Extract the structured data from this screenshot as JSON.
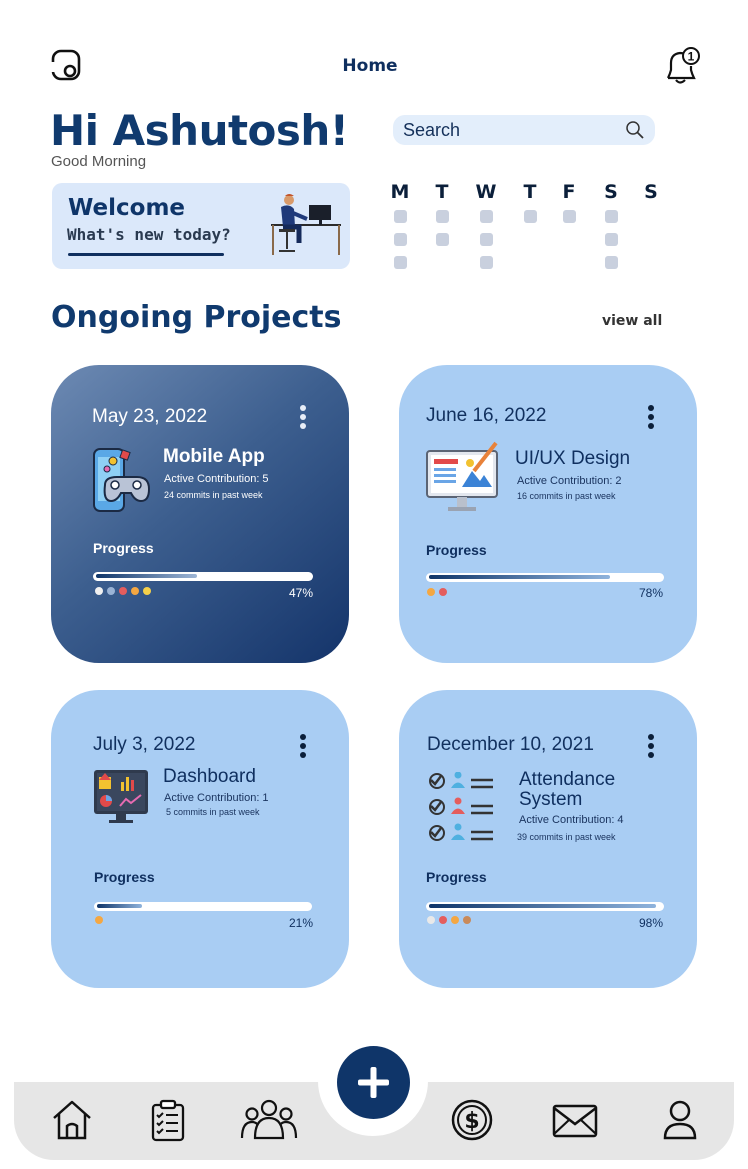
{
  "header": {
    "title": "Home",
    "notification_count": "1"
  },
  "greeting": {
    "title": "Hi Ashutosh!",
    "subtitle": "Good Morning"
  },
  "search": {
    "placeholder": "Search"
  },
  "welcome_card": {
    "title": "Welcome",
    "subtitle": "What's new today?"
  },
  "calendar": {
    "days": [
      "M",
      "T",
      "W",
      "T",
      "F",
      "S",
      "S"
    ],
    "dots_per_day": [
      3,
      2,
      3,
      1,
      1,
      3,
      0
    ]
  },
  "projects": {
    "title": "Ongoing Projects",
    "view_all": "view all",
    "items": [
      {
        "date": "May 23, 2022",
        "name": "Mobile App",
        "contribution": "Active Contribution: 5",
        "commits": "24 commits in past week",
        "progress_label": "Progress",
        "progress": 47,
        "progress_text": "47%",
        "avatar_icons": [
          "avatar",
          "avatar",
          "avatar",
          "avatar",
          "avatar"
        ],
        "icon": "gamepad-phone-icon"
      },
      {
        "date": "June 16, 2022",
        "name": "UI/UX Design",
        "contribution": "Active Contribution: 2",
        "commits": "16 commits in past week",
        "progress_label": "Progress",
        "progress": 78,
        "progress_text": "78%",
        "avatar_icons": [
          "avatar",
          "avatar"
        ],
        "icon": "design-monitor-icon"
      },
      {
        "date": "July 3, 2022",
        "name": "Dashboard",
        "contribution": "Active Contribution: 1",
        "commits": "5 commits in past week",
        "progress_label": "Progress",
        "progress": 21,
        "progress_text": "21%",
        "avatar_icons": [
          "avatar"
        ],
        "icon": "dashboard-monitor-icon"
      },
      {
        "date": "December 10, 2021",
        "name": "Attendance System",
        "contribution": "Active Contribution: 4",
        "commits": "39 commits in past week",
        "progress_label": "Progress",
        "progress": 98,
        "progress_text": "98%",
        "avatar_icons": [
          "avatar",
          "avatar",
          "avatar",
          "avatar"
        ],
        "icon": "attendance-list-icon"
      }
    ]
  },
  "bottom_nav": {
    "items": [
      "home-icon",
      "clipboard-icon",
      "team-icon",
      "dollar-icon",
      "mail-icon",
      "profile-icon"
    ],
    "fab": "plus-icon"
  },
  "colors": {
    "primary": "#0f3569",
    "card": "#a9cdf3",
    "accent_light": "#dbe8fa"
  }
}
